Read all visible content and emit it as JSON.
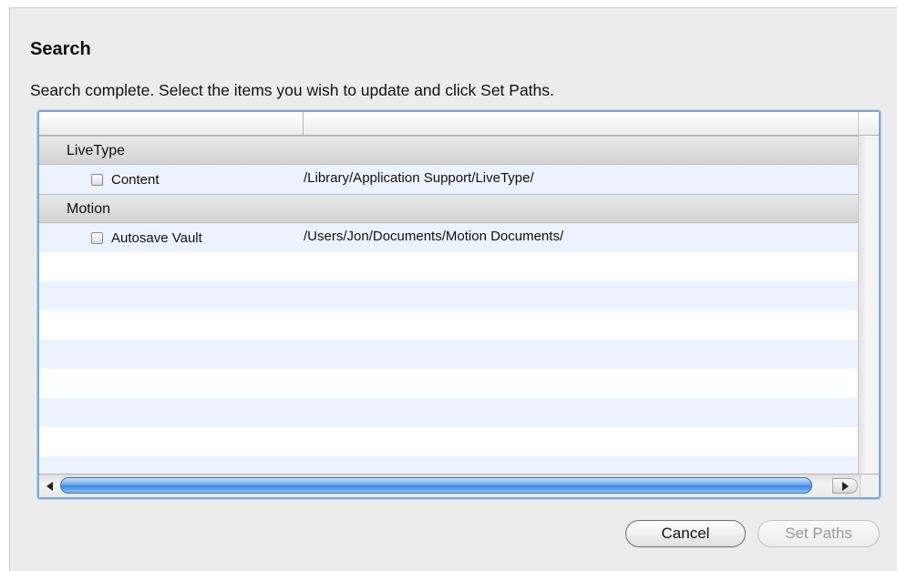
{
  "dialog": {
    "title": "Search",
    "message": "Search complete. Select the items you wish to update and click Set Paths."
  },
  "table": {
    "columns": [
      "",
      ""
    ],
    "groups": [
      {
        "label": "LiveType",
        "items": [
          {
            "name": "Content",
            "path": "/Library/Application Support/LiveType/",
            "checked": false
          }
        ]
      },
      {
        "label": "Motion",
        "items": [
          {
            "name": "Autosave Vault",
            "path": "/Users/Jon/Documents/Motion Documents/",
            "checked": false
          }
        ]
      }
    ]
  },
  "buttons": {
    "cancel": "Cancel",
    "set_paths": "Set Paths"
  },
  "colors": {
    "focus_ring": "#7da7d9",
    "stripe": "#edf3fe",
    "scroll_thumb": "#3f87e0"
  }
}
